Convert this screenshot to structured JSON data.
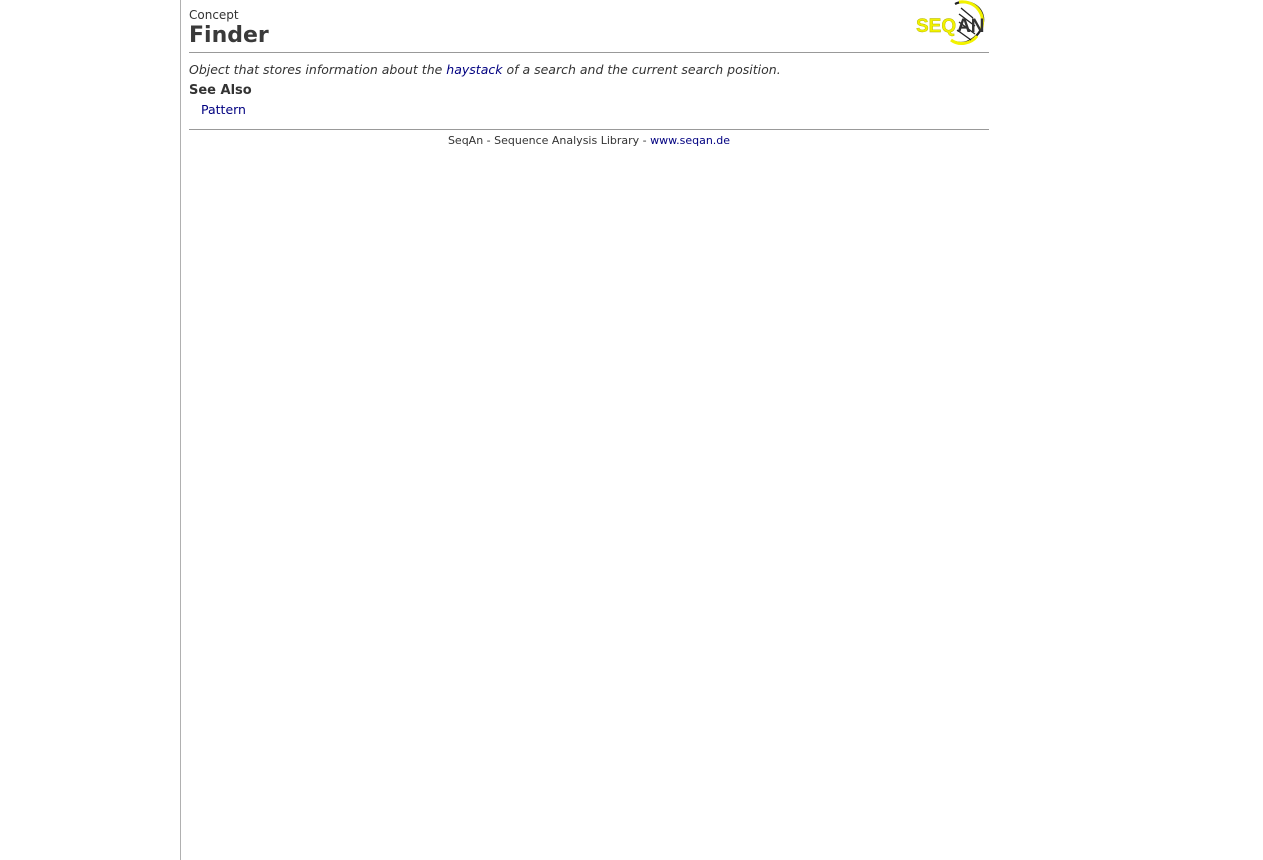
{
  "header": {
    "kind": "Concept",
    "title": "Finder",
    "logo_text": "SEQAN"
  },
  "summary": {
    "before": "Object that stores information about the ",
    "link_text": "haystack",
    "after": " of a search and the current search position."
  },
  "see_also": {
    "heading": "See Also",
    "items": [
      {
        "label": "Pattern"
      }
    ]
  },
  "footer": {
    "text": "SeqAn - Sequence Analysis Library - ",
    "link_text": "www.seqan.de"
  },
  "colors": {
    "link": "#000080",
    "logo_yellow": "#f2f200",
    "text": "#333333",
    "rule": "#999999"
  }
}
